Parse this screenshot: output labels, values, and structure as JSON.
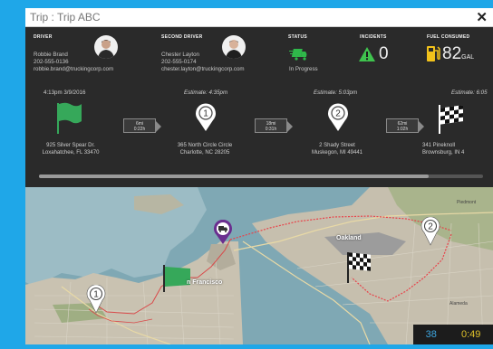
{
  "window": {
    "title": "Trip : Trip ABC",
    "close_symbol": "✕"
  },
  "header": {
    "driver": "DRIVER",
    "second_driver": "SECOND DRIVER",
    "status": "STATUS",
    "incidents": "INCIDENTS",
    "fuel_consumed": "FUEL CONSUMED"
  },
  "driver": {
    "name": "Robbie Brand",
    "phone": "202-555-0136",
    "email": "robbie.brand@truckingcorp.com"
  },
  "second_driver": {
    "name": "Chester Layton",
    "phone": "202-555-0174",
    "email": "chester.layton@truckingcorp.com"
  },
  "status": {
    "text": "In Progress",
    "color": "#2fb84a"
  },
  "incidents": {
    "count": "0",
    "color": "#3fc44e"
  },
  "fuel": {
    "value": "82",
    "unit": "GAL",
    "color": "#f2c21b"
  },
  "timeline": {
    "start_time": "4:13pm 3/9/2016",
    "stops": [
      {
        "estimate": "Estimate: 4:35pm",
        "number": "1"
      },
      {
        "estimate": "Estimate: 5:03pm",
        "number": "2"
      },
      {
        "estimate": "Estimate: 6:05"
      }
    ],
    "segments": [
      {
        "dist": "6mi",
        "time": "0:22h"
      },
      {
        "dist": "18mi",
        "time": "0:31h"
      },
      {
        "dist": "62mi",
        "time": "1:02h"
      }
    ],
    "addresses": [
      {
        "line1": "925 Silver Spear Dr.",
        "line2": "Loxahatchee, FL 33470"
      },
      {
        "line1": "365 North Circle Circle",
        "line2": "Charlotte, NC 28205"
      },
      {
        "line1": "2 Shady Street",
        "line2": "Muskegon, MI 49441"
      },
      {
        "line1": "341 Pineknoll",
        "line2": "Brownsburg, IN 4"
      }
    ]
  },
  "map": {
    "labels": {
      "oakland": "Oakland",
      "san_francisco": "n Francisco",
      "alameda": "Alameda",
      "piedmont": "Piedmont"
    },
    "markers": {
      "stop1": "1",
      "stop2": "2"
    },
    "stat_left": "38",
    "stat_right": "0:49"
  }
}
